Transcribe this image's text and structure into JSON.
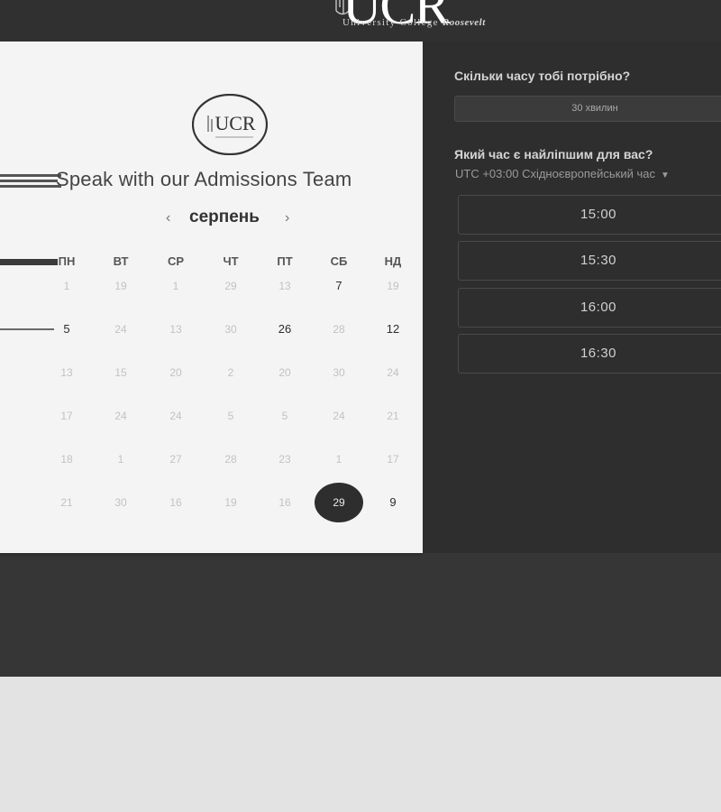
{
  "header": {
    "logo_text": "UCR",
    "logo_subtitle_prefix": "University College",
    "logo_subtitle_name": "Roosevelt"
  },
  "calendar": {
    "emblem_text": "UCR",
    "title": "Speak with our Admissions Team",
    "month": "серпень",
    "prev_icon": "‹",
    "next_icon": "›",
    "weekdays": [
      "ПН",
      "ВТ",
      "СР",
      "ЧТ",
      "ПТ",
      "СБ",
      "НД"
    ],
    "weeks": [
      [
        "1",
        "19",
        "1",
        "29",
        "13",
        "7",
        "19"
      ],
      [
        "5",
        "24",
        "13",
        "30",
        "26",
        "28",
        "12"
      ],
      [
        "13",
        "15",
        "20",
        "2",
        "20",
        "30",
        "24"
      ],
      [
        "17",
        "24",
        "24",
        "5",
        "5",
        "24",
        "21"
      ],
      [
        "18",
        "1",
        "27",
        "28",
        "23",
        "1",
        "17"
      ],
      [
        "21",
        "30",
        "16",
        "19",
        "16",
        "29",
        "9"
      ]
    ],
    "available_days": [
      [
        0,
        5
      ],
      [
        1,
        0
      ],
      [
        1,
        4
      ],
      [
        1,
        6
      ],
      [
        5,
        6
      ]
    ],
    "selected_day": [
      5,
      5
    ]
  },
  "booking": {
    "duration_question": "Скільки часу тобі потрібно?",
    "duration_value": "30 хвилин",
    "time_question": "Який час є найліпшим для вас?",
    "timezone": "UTC +03:00 Східноєвропейський час",
    "time_slots": [
      "15:00",
      "15:30",
      "16:00",
      "16:30"
    ]
  },
  "colors": {
    "header_bg": "#303030",
    "calendar_bg": "#f4f4f4",
    "panel_bg": "#2e2e2e",
    "selected_day_bg": "#2e2e2e",
    "page_bg": "#e3e3e3"
  }
}
